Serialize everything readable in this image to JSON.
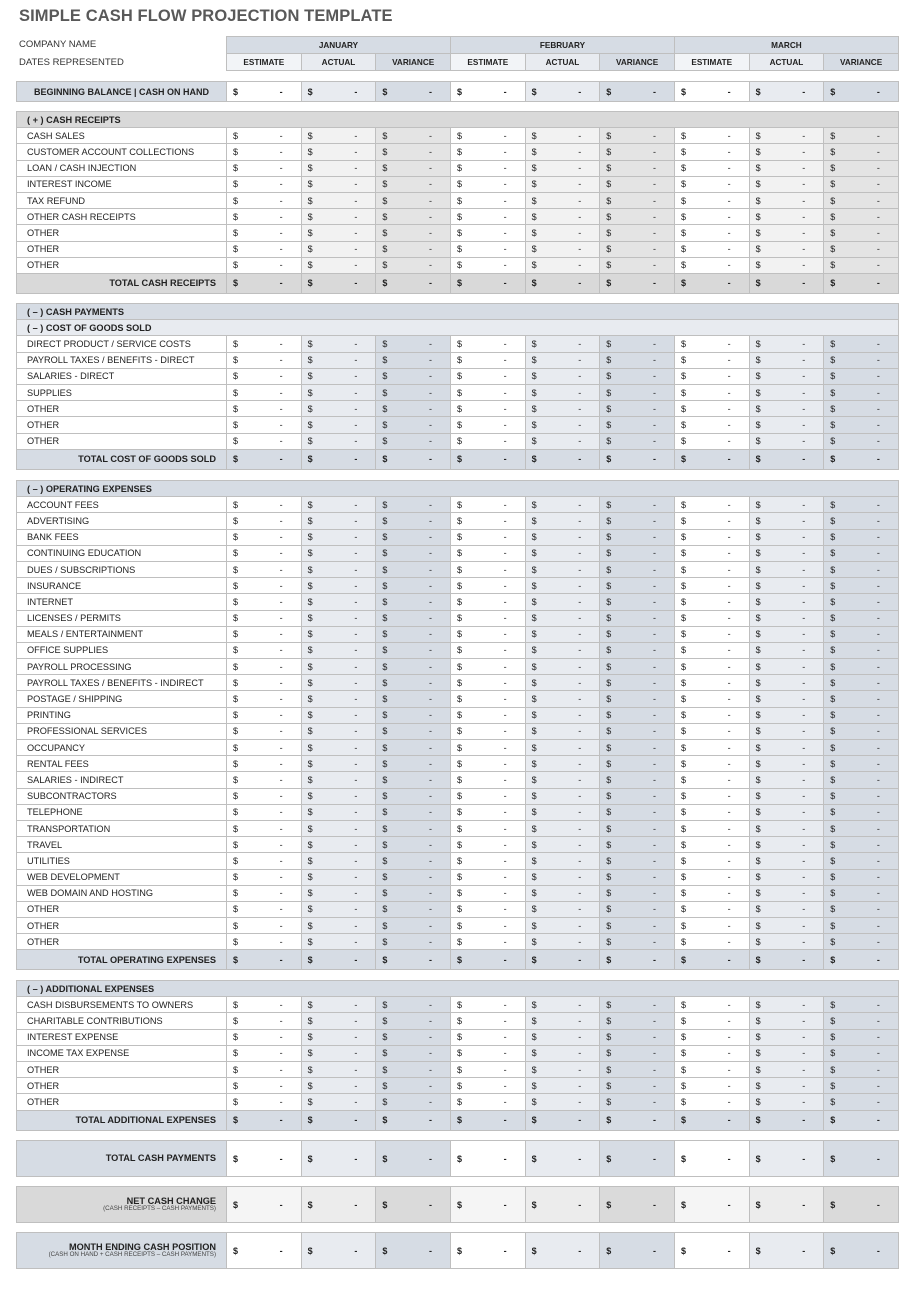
{
  "title": "SIMPLE CASH FLOW PROJECTION TEMPLATE",
  "company_label": "COMPANY NAME",
  "dates_label": "DATES REPRESENTED",
  "months": [
    "JANUARY",
    "FEBRUARY",
    "MARCH"
  ],
  "subcolumns": [
    "ESTIMATE",
    "ACTUAL",
    "VARIANCE"
  ],
  "currency_symbol": "$",
  "empty_value": "-",
  "beginning_balance": {
    "label": "BEGINNING BALANCE  |  CASH ON HAND"
  },
  "cash_receipts": {
    "header": "( + )  CASH RECEIPTS",
    "items": [
      "CASH SALES",
      "CUSTOMER ACCOUNT COLLECTIONS",
      "LOAN / CASH INJECTION",
      "INTEREST INCOME",
      "TAX REFUND",
      "OTHER CASH RECEIPTS",
      "OTHER",
      "OTHER",
      "OTHER"
    ],
    "total_label": "TOTAL CASH RECEIPTS"
  },
  "cash_payments": {
    "header": "( – )  CASH PAYMENTS",
    "cogs": {
      "header": "( – )  COST OF GOODS SOLD",
      "items": [
        "DIRECT PRODUCT / SERVICE COSTS",
        "PAYROLL TAXES / BENEFITS - DIRECT",
        "SALARIES - DIRECT",
        "SUPPLIES",
        "OTHER",
        "OTHER",
        "OTHER"
      ],
      "total_label": "TOTAL COST OF GOODS SOLD"
    },
    "operating": {
      "header": "( – )  OPERATING EXPENSES",
      "items": [
        "ACCOUNT FEES",
        "ADVERTISING",
        "BANK FEES",
        "CONTINUING EDUCATION",
        "DUES / SUBSCRIPTIONS",
        "INSURANCE",
        "INTERNET",
        "LICENSES / PERMITS",
        "MEALS / ENTERTAINMENT",
        "OFFICE SUPPLIES",
        "PAYROLL PROCESSING",
        "PAYROLL TAXES / BENEFITS - INDIRECT",
        "POSTAGE / SHIPPING",
        "PRINTING",
        "PROFESSIONAL SERVICES",
        "OCCUPANCY",
        "RENTAL FEES",
        "SALARIES - INDIRECT",
        "SUBCONTRACTORS",
        "TELEPHONE",
        "TRANSPORTATION",
        "TRAVEL",
        "UTILITIES",
        "WEB DEVELOPMENT",
        "WEB DOMAIN AND HOSTING",
        "OTHER",
        "OTHER",
        "OTHER"
      ],
      "total_label": "TOTAL OPERATING EXPENSES"
    },
    "additional": {
      "header": "( – )  ADDITIONAL EXPENSES",
      "items": [
        "CASH DISBURSEMENTS TO OWNERS",
        "CHARITABLE CONTRIBUTIONS",
        "INTEREST EXPENSE",
        "INCOME TAX EXPENSE",
        "OTHER",
        "OTHER",
        "OTHER"
      ],
      "total_label": "TOTAL ADDITIONAL EXPENSES"
    }
  },
  "total_cash_payments": {
    "label": "TOTAL CASH PAYMENTS"
  },
  "net_cash_change": {
    "label": "NET CASH CHANGE",
    "note": "(CASH RECEIPTS – CASH PAYMENTS)"
  },
  "month_ending": {
    "label": "MONTH ENDING CASH POSITION",
    "note": "(CASH ON HAND + CASH RECEIPTS – CASH PAYMENTS)"
  }
}
